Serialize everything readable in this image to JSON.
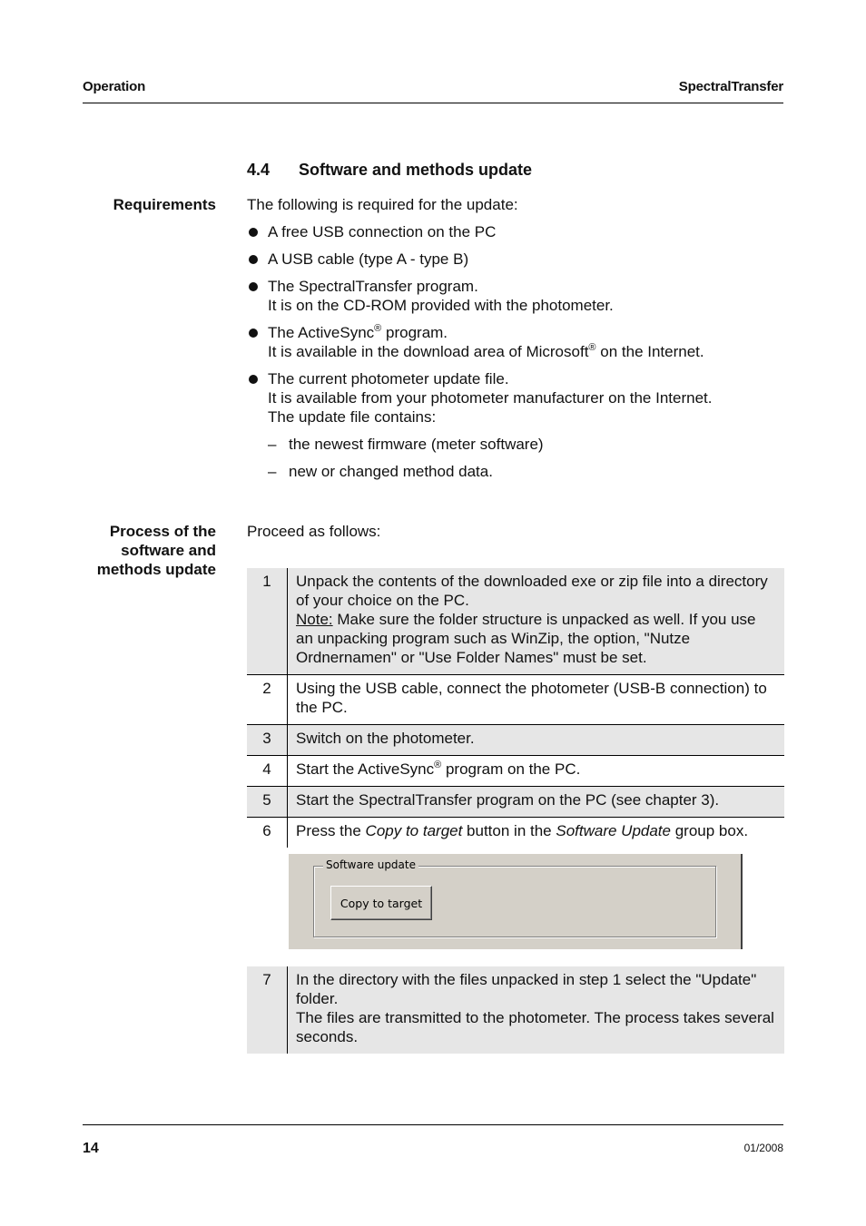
{
  "header": {
    "left": "Operation",
    "right": "SpectralTransfer"
  },
  "section": {
    "number": "4.4",
    "title": "Software and methods update"
  },
  "requirements": {
    "side_label": "Requirements",
    "intro": "The following is required for the update:",
    "items": [
      {
        "line1": "A free USB connection on the PC"
      },
      {
        "line1": "A USB cable (type A - type B)"
      },
      {
        "line1": "The SpectralTransfer program.",
        "line2": "It is on the CD-ROM provided with the photometer."
      },
      {
        "line1_a": "The ActiveSync",
        "line1_b": " program.",
        "line2_a": "It is available in the download area of Microsoft",
        "line2_b": " on the Internet.",
        "reg": "®"
      },
      {
        "line1": "The current photometer update file.",
        "line2": "It is available from your photometer manufacturer on the Internet.",
        "line3": "The update file contains:"
      }
    ],
    "subitems": [
      "the newest firmware (meter software)",
      "new or changed method data."
    ],
    "dash": "–"
  },
  "process": {
    "side_label_1": "Process of the",
    "side_label_2": "software and",
    "side_label_3": "methods update",
    "intro": "Proceed as follows:",
    "steps": [
      {
        "n": "1",
        "text_a": "Unpack the contents of the downloaded exe or zip file into a directory of your choice on the PC.",
        "note_label": "Note:",
        "note_text": " Make sure the folder structure is unpacked as well. If you use an unpacking program such as WinZip, the option, \"Nutze Ordnernamen\" or \"Use Folder Names\" must be set."
      },
      {
        "n": "2",
        "text": "Using the USB cable, connect the photometer (USB-B connection) to the PC."
      },
      {
        "n": "3",
        "text": "Switch on the photometer."
      },
      {
        "n": "4",
        "text_a": "Start the ActiveSync",
        "reg": "®",
        "text_b": " program on the PC."
      },
      {
        "n": "5",
        "text": "Start the SpectralTransfer program on the PC (see chapter 3)."
      },
      {
        "n": "6",
        "text_a": "Press the ",
        "em_1": "Copy to target",
        "text_b": " button in the ",
        "em_2": "Software Update",
        "text_c": " group box."
      },
      {
        "n": "7",
        "line1": "In the directory with the files unpacked in step 1 select the \"Update\" folder.",
        "line2": "The files are transmitted to the photometer. The process takes several seconds."
      }
    ],
    "screenshot": {
      "group_label": "Software update",
      "button_label": "Copy to target"
    }
  },
  "footer": {
    "page_number": "14",
    "date": "01/2008"
  }
}
